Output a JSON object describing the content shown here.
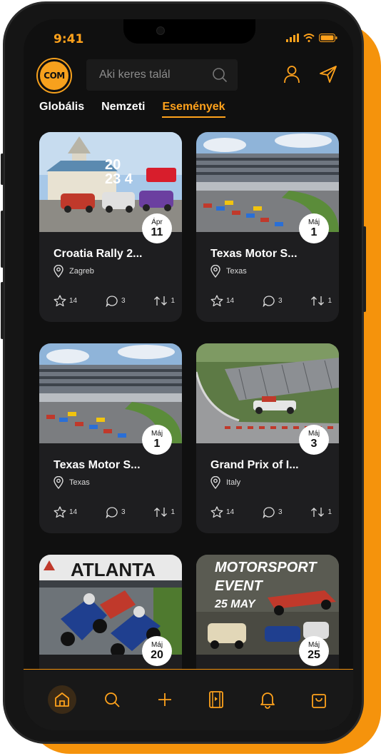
{
  "status": {
    "time": "9:41"
  },
  "header": {
    "logo_text": "COM",
    "search_placeholder": "Aki keres talál"
  },
  "tabs": [
    {
      "label": "Globális"
    },
    {
      "label": "Nemzeti"
    },
    {
      "label": "Események"
    }
  ],
  "active_tab": "Események",
  "cards": [
    {
      "title": "Croatia Rally 2...",
      "location": "Zagreb",
      "month": "Ápr",
      "day": "11",
      "likes": "14",
      "comments": "3",
      "shares": "1",
      "image": "croatia-rally-poster"
    },
    {
      "title": "Texas Motor S...",
      "location": "Texas",
      "month": "Máj",
      "day": "1",
      "likes": "14",
      "comments": "3",
      "shares": "1",
      "image": "speedway-race"
    },
    {
      "title": "Texas Motor S...",
      "location": "Texas",
      "month": "Máj",
      "day": "1",
      "likes": "14",
      "comments": "3",
      "shares": "1",
      "image": "speedway-race"
    },
    {
      "title": "Grand Prix of I...",
      "location": "Italy",
      "month": "Máj",
      "day": "3",
      "likes": "14",
      "comments": "3",
      "shares": "1",
      "image": "f1-track"
    },
    {
      "title": "",
      "location": "",
      "month": "Máj",
      "day": "20",
      "likes": "",
      "comments": "",
      "shares": "",
      "image": "atlanta-motorcycles",
      "banner": "ATLANTA"
    },
    {
      "title": "",
      "location": "",
      "month": "Máj",
      "day": "25",
      "likes": "",
      "comments": "",
      "shares": "",
      "image": "motorsport-event-poster",
      "poster_line1": "MOTORSPORT",
      "poster_line2": "EVENT",
      "poster_line3": "25 MAY"
    }
  ],
  "bottom_nav": [
    {
      "icon": "home-icon",
      "active": true
    },
    {
      "icon": "search-icon",
      "active": false
    },
    {
      "icon": "plus-icon",
      "active": false
    },
    {
      "icon": "film-icon",
      "active": false
    },
    {
      "icon": "bell-icon",
      "active": false
    },
    {
      "icon": "bag-icon",
      "active": false
    }
  ],
  "colors": {
    "accent": "#ffa21c",
    "background": "#101010",
    "card": "#1e1e20"
  }
}
